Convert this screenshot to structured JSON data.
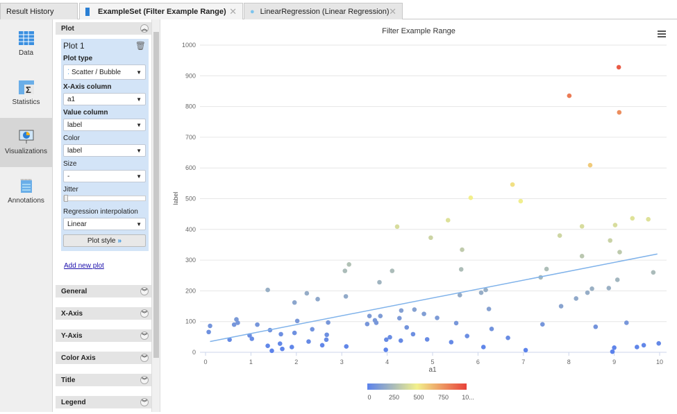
{
  "tabs": [
    {
      "label": "Result History"
    },
    {
      "label": "ExampleSet (Filter Example Range)",
      "active": true
    },
    {
      "label": "LinearRegression (Linear Regression)"
    }
  ],
  "nav": [
    {
      "label": "Data"
    },
    {
      "label": "Statistics"
    },
    {
      "label": "Visualizations",
      "active": true
    },
    {
      "label": "Annotations"
    }
  ],
  "panel": {
    "plot_section": "Plot",
    "plot_name": "Plot 1",
    "plot_type_label": "Plot type",
    "plot_type": "Scatter / Bubble",
    "x_axis_label": "X-Axis column",
    "x_axis": "a1",
    "value_label": "Value column",
    "value": "label",
    "color_label": "Color",
    "color": "label",
    "size_label": "Size",
    "size": "-",
    "jitter_label": "Jitter",
    "jitter": 0,
    "regression_label": "Regression interpolation",
    "regression": "Linear",
    "plot_style": "Plot style",
    "add_plot": "Add new plot",
    "sections": [
      "General",
      "X-Axis",
      "Y-Axis",
      "Color Axis",
      "Title",
      "Legend"
    ]
  },
  "colors": {
    "low": "#5b82ec",
    "mid": "#f2f08c",
    "high": "#e8423a",
    "regression": "#7fb2ea"
  },
  "chart_data": {
    "type": "scatter",
    "title": "Filter Example Range",
    "xlabel": "a1",
    "ylabel": "label",
    "xlim": [
      0,
      10
    ],
    "ylim": [
      0,
      1000
    ],
    "xticks": [
      "0",
      "1",
      "2",
      "3",
      "4",
      "5",
      "6",
      "7",
      "8",
      "9",
      "10"
    ],
    "yticks": [
      "0",
      "100",
      "200",
      "300",
      "400",
      "500",
      "600",
      "700",
      "800",
      "900",
      "1000"
    ],
    "color_scale": {
      "min": 0,
      "max": 1000,
      "ticks": [
        "0",
        "250",
        "500",
        "750",
        "10..."
      ]
    },
    "regression": {
      "type": "linear",
      "x": [
        0.1,
        9.95
      ],
      "y": [
        35,
        320
      ]
    },
    "points": [
      [
        0.07,
        66
      ],
      [
        0.1,
        86
      ],
      [
        0.53,
        41
      ],
      [
        0.63,
        90
      ],
      [
        0.68,
        107
      ],
      [
        0.71,
        96
      ],
      [
        0.97,
        55
      ],
      [
        1.02,
        44
      ],
      [
        1.14,
        90
      ],
      [
        1.37,
        203
      ],
      [
        1.37,
        21
      ],
      [
        1.42,
        72
      ],
      [
        1.46,
        5
      ],
      [
        1.64,
        28
      ],
      [
        1.66,
        59
      ],
      [
        1.69,
        11
      ],
      [
        1.9,
        17
      ],
      [
        1.96,
        162
      ],
      [
        1.96,
        63
      ],
      [
        2.02,
        102
      ],
      [
        2.23,
        192
      ],
      [
        2.27,
        35
      ],
      [
        2.35,
        75
      ],
      [
        2.47,
        173
      ],
      [
        2.57,
        23
      ],
      [
        2.66,
        41
      ],
      [
        2.67,
        57
      ],
      [
        2.7,
        97
      ],
      [
        3.07,
        265
      ],
      [
        3.16,
        286
      ],
      [
        3.09,
        182
      ],
      [
        3.1,
        19
      ],
      [
        3.56,
        92
      ],
      [
        3.61,
        118
      ],
      [
        3.73,
        104
      ],
      [
        3.76,
        96
      ],
      [
        3.83,
        228
      ],
      [
        3.85,
        118
      ],
      [
        3.97,
        8
      ],
      [
        3.98,
        41
      ],
      [
        4.06,
        49
      ],
      [
        4.11,
        265
      ],
      [
        4.22,
        409
      ],
      [
        4.27,
        111
      ],
      [
        4.31,
        136
      ],
      [
        4.3,
        38
      ],
      [
        4.43,
        81
      ],
      [
        4.57,
        59
      ],
      [
        4.6,
        139
      ],
      [
        4.81,
        125
      ],
      [
        4.88,
        42
      ],
      [
        4.96,
        373
      ],
      [
        5.1,
        112
      ],
      [
        5.34,
        430
      ],
      [
        5.41,
        33
      ],
      [
        5.52,
        95
      ],
      [
        5.6,
        186
      ],
      [
        5.63,
        270
      ],
      [
        5.65,
        334
      ],
      [
        5.76,
        53
      ],
      [
        5.84,
        503
      ],
      [
        6.07,
        194
      ],
      [
        6.12,
        17
      ],
      [
        6.17,
        203
      ],
      [
        6.24,
        141
      ],
      [
        6.3,
        76
      ],
      [
        6.66,
        47
      ],
      [
        6.76,
        546
      ],
      [
        6.94,
        492
      ],
      [
        7.05,
        7
      ],
      [
        7.38,
        244
      ],
      [
        7.42,
        91
      ],
      [
        7.51,
        271
      ],
      [
        7.8,
        380
      ],
      [
        7.83,
        150
      ],
      [
        8.01,
        835
      ],
      [
        8.16,
        175
      ],
      [
        8.29,
        410
      ],
      [
        8.29,
        313
      ],
      [
        8.41,
        194
      ],
      [
        8.47,
        609
      ],
      [
        8.51,
        207
      ],
      [
        8.59,
        83
      ],
      [
        8.88,
        209
      ],
      [
        8.91,
        364
      ],
      [
        8.96,
        2
      ],
      [
        9.0,
        15
      ],
      [
        9.02,
        414
      ],
      [
        9.07,
        236
      ],
      [
        9.1,
        928
      ],
      [
        9.11,
        781
      ],
      [
        9.12,
        326
      ],
      [
        9.27,
        96
      ],
      [
        9.4,
        436
      ],
      [
        9.5,
        17
      ],
      [
        9.65,
        23
      ],
      [
        9.75,
        433
      ],
      [
        9.86,
        260
      ],
      [
        9.98,
        29
      ]
    ]
  }
}
